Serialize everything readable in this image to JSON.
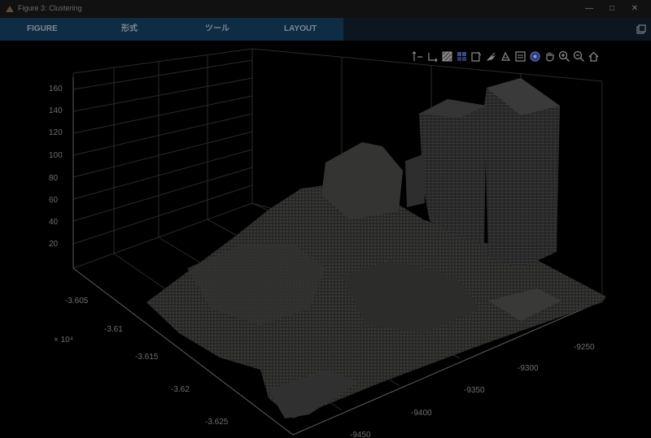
{
  "window": {
    "title": "Figure 3: Clustering"
  },
  "ribbon": {
    "tabs": [
      {
        "label": "FIGURE"
      },
      {
        "label": "形式"
      },
      {
        "label": "ツール"
      },
      {
        "label": "LAYOUT"
      }
    ]
  },
  "toolbar": {
    "icons": [
      "rotate-x-icon",
      "rotate-y-icon",
      "datatip-grid-icon",
      "colormap-icon",
      "export-icon",
      "brush-icon",
      "erase-icon",
      "legend-icon",
      "rotate-3d-icon",
      "pan-icon",
      "zoom-in-icon",
      "zoom-out-icon",
      "home-icon"
    ]
  },
  "axes": {
    "z_ticks": [
      "160",
      "140",
      "120",
      "100",
      "80",
      "60",
      "40",
      "20"
    ],
    "y_ticks": [
      "-3.605",
      "-3.61",
      "-3.615",
      "-3.62",
      "-3.625"
    ],
    "y_exponent": "× 10⁴",
    "x_ticks": [
      "-9250",
      "-9300",
      "-9350",
      "-9400",
      "-9450"
    ],
    "grid": true
  }
}
